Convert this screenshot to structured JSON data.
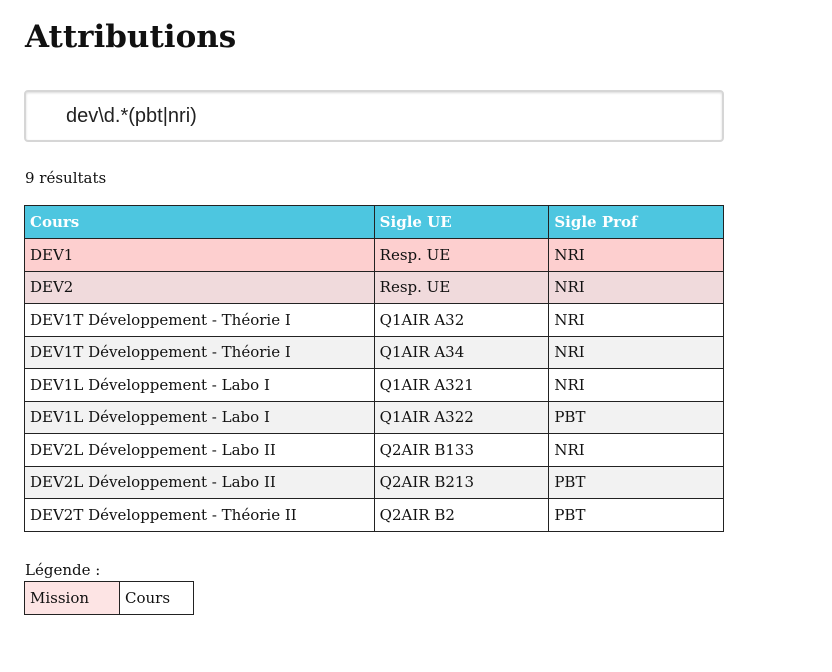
{
  "page": {
    "title": "Attributions"
  },
  "search": {
    "value": "dev\\d.*(pbt|nri)",
    "placeholder": ""
  },
  "results": {
    "count_text": "9 résultats"
  },
  "table": {
    "headers": [
      "Cours",
      "Sigle UE",
      "Sigle Prof"
    ],
    "rows": [
      {
        "cours": "DEV1",
        "ue": "Resp. UE",
        "prof": "NRI",
        "kind": "mission"
      },
      {
        "cours": "DEV2",
        "ue": "Resp. UE",
        "prof": "NRI",
        "kind": "mission"
      },
      {
        "cours": "DEV1T Développement - Théorie I",
        "ue": "Q1AIR A32",
        "prof": "NRI",
        "kind": "cours"
      },
      {
        "cours": "DEV1T Développement - Théorie I",
        "ue": "Q1AIR A34",
        "prof": "NRI",
        "kind": "cours"
      },
      {
        "cours": "DEV1L Développement - Labo I",
        "ue": "Q1AIR A321",
        "prof": "NRI",
        "kind": "cours"
      },
      {
        "cours": "DEV1L Développement - Labo I",
        "ue": "Q1AIR A322",
        "prof": "PBT",
        "kind": "cours"
      },
      {
        "cours": "DEV2L Développement - Labo II",
        "ue": "Q2AIR B133",
        "prof": "NRI",
        "kind": "cours"
      },
      {
        "cours": "DEV2L Développement - Labo II",
        "ue": "Q2AIR B213",
        "prof": "PBT",
        "kind": "cours"
      },
      {
        "cours": "DEV2T Développement - Théorie II",
        "ue": "Q2AIR B2",
        "prof": "PBT",
        "kind": "cours"
      }
    ]
  },
  "legend": {
    "label": "Légende :",
    "mission": "Mission",
    "cours": "Cours"
  },
  "colors": {
    "header_bg": "#4dc6e0",
    "mission_row": "#fdcfcf",
    "mission_row_alt": "#f0dadc",
    "cours_row_alt": "#f2f2f2"
  }
}
